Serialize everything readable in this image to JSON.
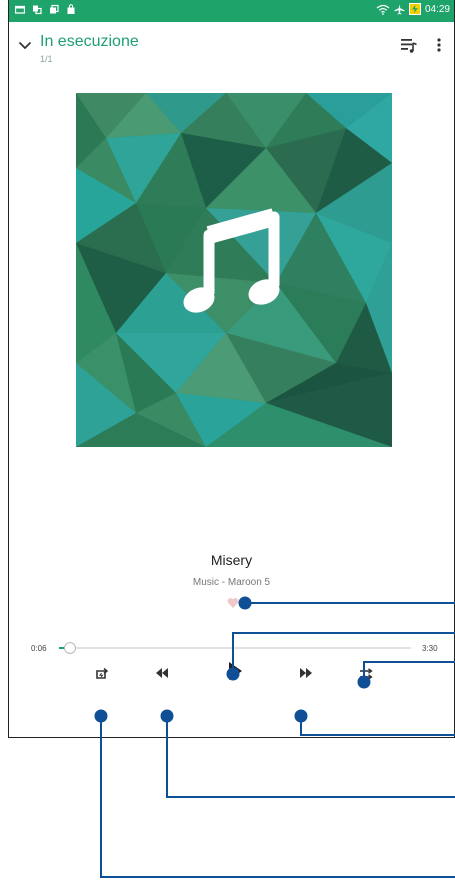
{
  "status_bar": {
    "time": "04:29",
    "background_color": "#1ea36a",
    "left_icons": [
      "screen-icon",
      "notification-icon",
      "gallery-icon",
      "shopping-bag-icon"
    ],
    "right_icons": [
      "wifi-icon",
      "airplane-icon",
      "battery-charging-icon"
    ]
  },
  "header": {
    "title": "In esecuzione",
    "queue_position": "1/1",
    "accent_color": "#1e9f73"
  },
  "now_playing": {
    "track_title": "Misery",
    "subtitle": "Music - Maroon 5",
    "album_art_icon": "music-note-icon"
  },
  "progress": {
    "elapsed": "0:06",
    "total": "3:30",
    "fraction": 0.03
  },
  "controls": [
    "repeat-icon",
    "previous-icon",
    "play-icon",
    "next-icon",
    "shuffle-icon"
  ]
}
